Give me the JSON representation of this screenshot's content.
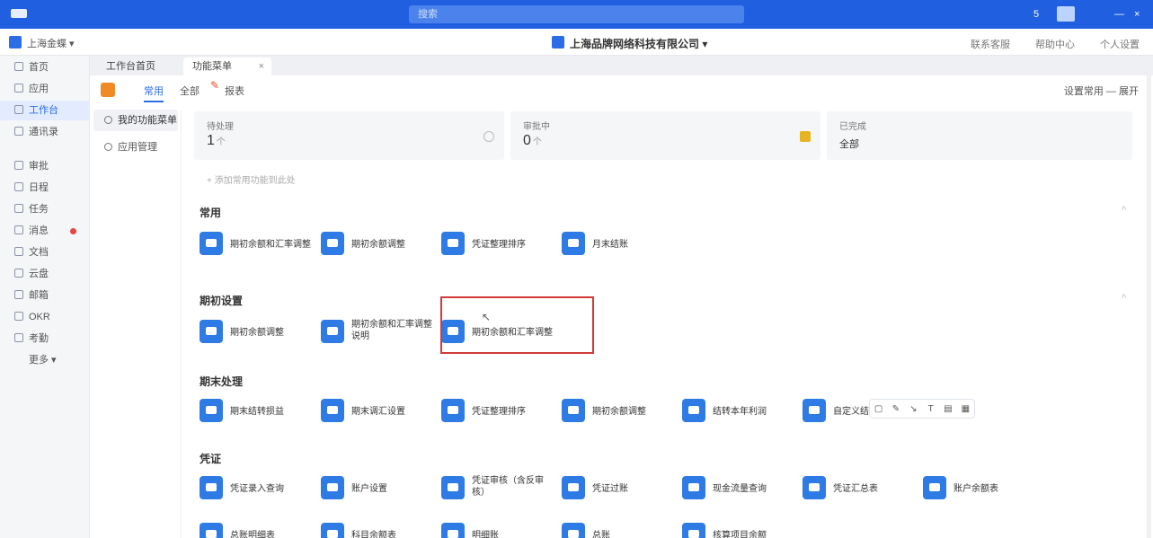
{
  "window": {
    "search_placeholder": "搜索",
    "btn_right_1": "5",
    "btn_right_2": "—",
    "btn_right_3": "×"
  },
  "header": {
    "org_name": "上海金蝶 ▾",
    "company_name": "上海品牌网络科技有限公司 ▾",
    "link_1": "联系客服",
    "link_2": "帮助中心",
    "link_3": "个人设置"
  },
  "nav": {
    "items": [
      {
        "label": "首页"
      },
      {
        "label": "应用"
      },
      {
        "label": "工作台"
      },
      {
        "label": "通讯录"
      },
      {
        "label": "审批"
      },
      {
        "label": "日程"
      },
      {
        "label": "任务"
      },
      {
        "label": "消息"
      },
      {
        "label": "文档"
      },
      {
        "label": "云盘"
      },
      {
        "label": "邮箱"
      },
      {
        "label": "OKR"
      },
      {
        "label": "考勤"
      },
      {
        "label": "更多 ▾"
      }
    ]
  },
  "tabs": {
    "home_label": "工作台首页",
    "current_label": "功能菜单",
    "close": "×"
  },
  "panel": {
    "tab_common": "常用",
    "tab_all": "全部",
    "tab_report": "报表",
    "right_controls": "设置常用 — 展开",
    "submenu": [
      {
        "label": "我的功能菜单"
      },
      {
        "label": "应用管理"
      }
    ],
    "stats": [
      {
        "label": "待处理",
        "value": "1",
        "unit": "个"
      },
      {
        "label": "审批中",
        "value": "0",
        "unit": "个"
      },
      {
        "label": "已完成",
        "value": "",
        "unit": "全部"
      }
    ],
    "filter_text": "+ 添加常用功能到此处"
  },
  "sections": [
    {
      "title": "常用",
      "items": [
        {
          "label": "期初余额和汇率调整"
        },
        {
          "label": "期初余额调整"
        },
        {
          "label": "凭证整理排序"
        },
        {
          "label": "月末结账"
        }
      ]
    },
    {
      "title": "期初设置",
      "items": [
        {
          "label": "期初余额调整"
        },
        {
          "label": "期初余额和汇率调整说明"
        },
        {
          "label": "期初余额和汇率调整"
        }
      ]
    },
    {
      "title": "期末处理",
      "items": [
        {
          "label": "期末结转损益"
        },
        {
          "label": "期末调汇设置"
        },
        {
          "label": "凭证整理排序"
        },
        {
          "label": "期初余额调整"
        },
        {
          "label": "结转本年利润"
        },
        {
          "label": "自定义结转"
        }
      ]
    },
    {
      "title": "凭证",
      "items": [
        {
          "label": "凭证录入查询"
        },
        {
          "label": "账户设置"
        },
        {
          "label": "凭证审核（含反审核）"
        },
        {
          "label": "凭证过账"
        },
        {
          "label": "现金流量查询"
        },
        {
          "label": "凭证汇总表"
        },
        {
          "label": "账户余额表"
        }
      ]
    },
    {
      "title": "",
      "items": [
        {
          "label": "总账明细表"
        },
        {
          "label": "科目余额表"
        },
        {
          "label": "明细账"
        },
        {
          "label": "总账"
        },
        {
          "label": "核算项目余额"
        }
      ]
    }
  ],
  "colors": {
    "brand_blue": "#1f5fe0",
    "icon_blue": "#2e7be6",
    "highlight_red": "#d23a3a",
    "alert_dot": "#e54545"
  }
}
